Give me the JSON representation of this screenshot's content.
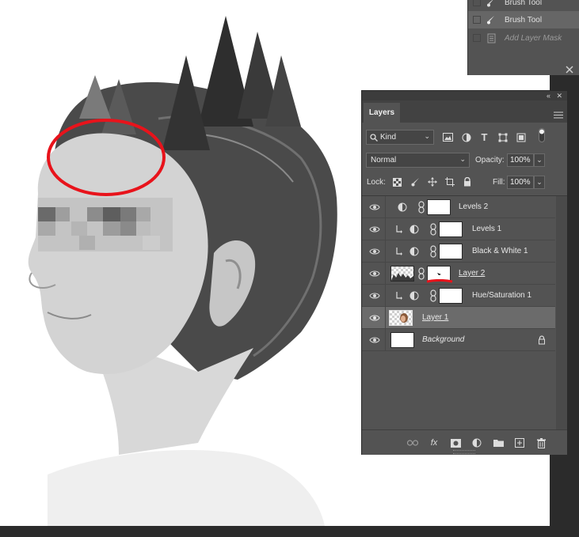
{
  "history": {
    "items": [
      {
        "label": "Brush Tool",
        "active": false,
        "dim": false
      },
      {
        "label": "Brush Tool",
        "active": true,
        "dim": false
      },
      {
        "label": "Add Layer Mask",
        "active": false,
        "dim": true
      }
    ]
  },
  "layers_panel": {
    "tab_label": "Layers",
    "filter_kind": "Kind",
    "blend_mode": "Normal",
    "opacity_label": "Opacity:",
    "opacity_value": "100%",
    "lock_label": "Lock:",
    "fill_label": "Fill:",
    "fill_value": "100%",
    "layers": [
      {
        "name": "Levels 2",
        "type": "adjustment",
        "clipped": false
      },
      {
        "name": "Levels 1",
        "type": "adjustment",
        "clipped": true
      },
      {
        "name": "Black & White 1",
        "type": "adjustment",
        "clipped": true
      },
      {
        "name": "Layer 2",
        "type": "pixel-mask",
        "clipped": false
      },
      {
        "name": "Hue/Saturation 1",
        "type": "adjustment",
        "clipped": true
      },
      {
        "name": "Layer 1",
        "type": "pixel",
        "clipped": false,
        "selected": true
      },
      {
        "name": "Background",
        "type": "background",
        "locked": true
      }
    ]
  },
  "colors": {
    "panel_bg": "#535353",
    "selected_row": "#6b6b6b",
    "annotation_red": "#e8131b",
    "workspace_dark": "#2b2b2b"
  }
}
